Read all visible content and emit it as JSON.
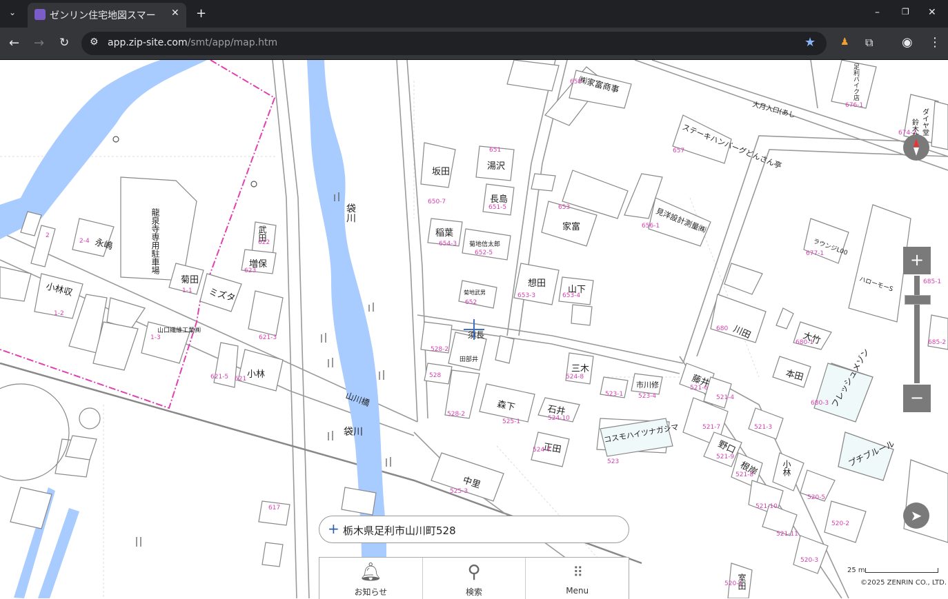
{
  "browser": {
    "tab_title": "ゼンリン住宅地図スマー",
    "url_host": "app.zip-site.com",
    "url_path": "/smt/app/map.htm"
  },
  "map": {
    "labels": {
      "b1": "袋川",
      "b2": "袋川",
      "bridge": "山川橋",
      "ryusen": "龍泉寺専用駐車場",
      "eishima": "永嶋",
      "kobayashi_s": "小林収",
      "kikuta": "菊田",
      "mizuta": "ミズタ",
      "masuho": "増保",
      "takeda": "武田",
      "yamaguchi": "山口繊維工業㈱",
      "yamaguchi2": "山口",
      "kobayashi": "小林",
      "sakata": "坂田",
      "yuzawa": "湯沢",
      "nagashima": "長島",
      "inaba": "稲葉",
      "kikuchi": "菊地信太郎",
      "kikuchi2": "菊地武男",
      "sudo": "須長",
      "tanabe": "田部井",
      "soda": "想田",
      "yamashita": "山下",
      "ietomi": "家富",
      "ietomi_co": "㈱家富商事",
      "steak": "ステーキハンバーグどんさん亭",
      "mitate": "見洋設計測量㈱",
      "lounge": "ラウンジL00",
      "hello": "ハローモーS",
      "kawata": "川田",
      "otake": "大竹",
      "honda": "本田",
      "mitsugi": "三木",
      "morishita": "森下",
      "ishii": "石井",
      "masada": "正田",
      "ichikawa": "市川修",
      "cosmo": "コスモハイツナガシマ",
      "fujii": "藤井",
      "noguchi": "野口",
      "nekishi": "根岸",
      "komori": "小林",
      "nakazato": "中里",
      "petit": "プチブルール",
      "fresh": "フレッシュメゾン",
      "horii": "室田",
      "busstop": "大月入口(あし",
      "daiya": "ダイヤ堂",
      "suzuki": "鈴木敬夫",
      "hachiya": "足利バイク店"
    }
  },
  "address_search": {
    "value": "栃木県足利市山川町528"
  },
  "bottom_nav": [
    {
      "label": "お知らせ"
    },
    {
      "label": "検索"
    },
    {
      "label": "Menu"
    }
  ],
  "scale_label": "25 m",
  "copyright": "©2025 ZENRIN CO., LTD.",
  "colors": {
    "river": "#a8ccff",
    "boundary": "#e040b0",
    "control": "#7a7a7a"
  }
}
